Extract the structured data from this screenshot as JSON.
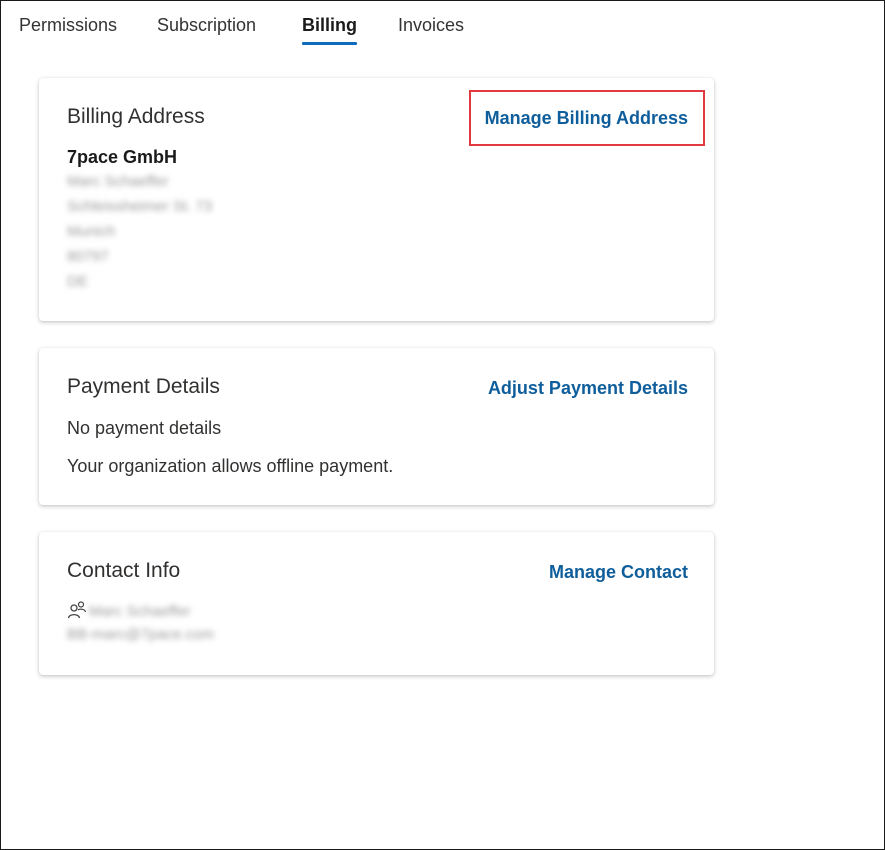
{
  "tabs": [
    {
      "label": "Permissions",
      "active": false
    },
    {
      "label": "Subscription",
      "active": false
    },
    {
      "label": "Billing",
      "active": true
    },
    {
      "label": "Invoices",
      "active": false
    }
  ],
  "billing_address": {
    "title": "Billing Address",
    "action": "Manage Billing Address",
    "company": "7pace GmbH",
    "lines": [
      "Marc Schaeffer",
      "Schleissheimer St. 73",
      "Munich",
      "80797",
      "DE"
    ]
  },
  "payment_details": {
    "title": "Payment Details",
    "action": "Adjust Payment Details",
    "status": "No payment details",
    "note": "Your organization allows offline payment."
  },
  "contact_info": {
    "title": "Contact Info",
    "action": "Manage Contact",
    "name": "Marc Schaeffer",
    "email": "BB-marc@7pace.com",
    "icon": "contact-people-icon"
  },
  "colors": {
    "accent": "#0f6cbd",
    "link": "#0f5e9c",
    "highlight": "#e0393e"
  }
}
